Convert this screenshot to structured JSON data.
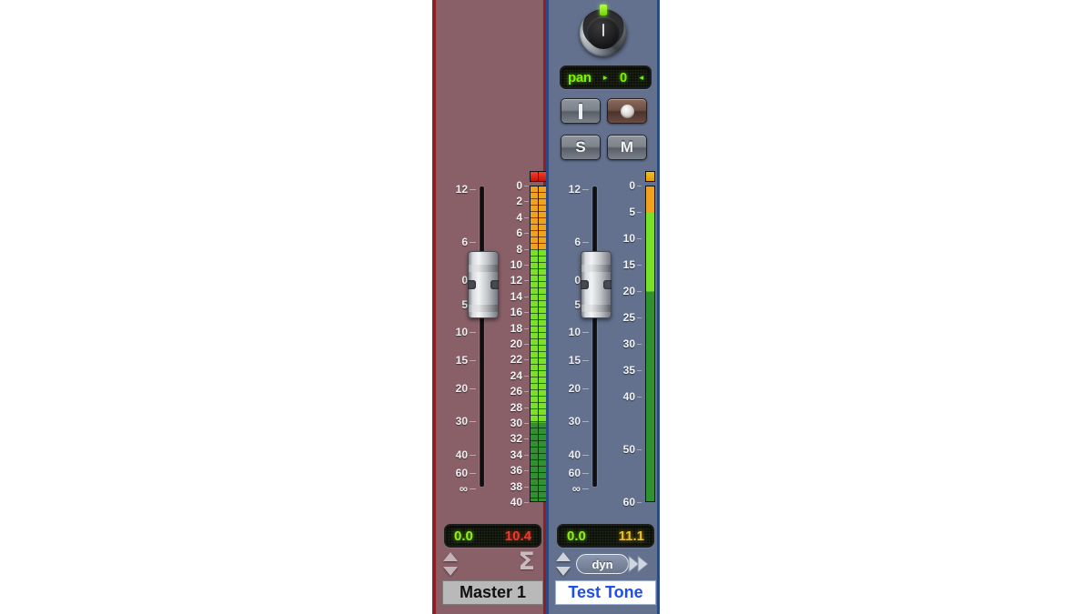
{
  "app": {
    "kind": "audio-mixer-channel-strips",
    "colors": {
      "master_strip_bg": "#8a6068",
      "master_strip_border": "#8e1f22",
      "track_strip_bg": "#63718f",
      "track_strip_border": "#2a4a86",
      "lcd_green": "#7bf007",
      "clip_red": "#d81f12",
      "peak_amber": "#f2c018",
      "meter_orange": "#f0a21e",
      "meter_green_bright": "#7ae02a",
      "meter_green_dark": "#2f9130"
    }
  },
  "strips": [
    {
      "id": "master",
      "name_label": "Master 1",
      "name_color": "#101010",
      "name_bg": "#b9b9b9",
      "has_pan_knob": false,
      "has_buttons": false,
      "fader": {
        "position_db": "0",
        "scale_labels": [
          "12",
          "6",
          "0",
          "5",
          "10",
          "15",
          "20",
          "30",
          "40",
          "60",
          "∞"
        ]
      },
      "meter": {
        "style": "stereo-segmented",
        "scale_labels": [
          "0",
          "2",
          "4",
          "6",
          "8",
          "10",
          "12",
          "14",
          "16",
          "18",
          "20",
          "22",
          "24",
          "26",
          "28",
          "30",
          "32",
          "34",
          "36",
          "38",
          "40"
        ],
        "clip_indicator": "on",
        "clip_color": "#d81f12",
        "orange_from_db": 0,
        "orange_to_db": 8,
        "bright_green_to_db": 30,
        "dark_green_to_db": 40,
        "level_db": 0
      },
      "value_display": {
        "left": "0.0",
        "right": "10.4",
        "left_color": "#8ef016",
        "right_color": "#f0392a"
      },
      "bottom_icons": {
        "spinner": "updown-spinner-icon",
        "right": "sigma-icon",
        "right_glyph": "Σ"
      }
    },
    {
      "id": "track",
      "name_label": "Test Tone",
      "name_color": "#1d4ff0",
      "name_bg": "#ffffff",
      "has_pan_knob": true,
      "has_buttons": true,
      "pan": {
        "label": "pan",
        "value": "0",
        "left_arrow": "▸",
        "right_arrow": "◂"
      },
      "buttons": [
        {
          "id": "input",
          "label": "I",
          "icon": "input-bar-icon",
          "state": "off"
        },
        {
          "id": "record",
          "label": "",
          "icon": "record-dot-icon",
          "state": "armed"
        },
        {
          "id": "solo",
          "label": "S",
          "icon": "",
          "state": "off"
        },
        {
          "id": "mute",
          "label": "M",
          "icon": "",
          "state": "off"
        }
      ],
      "fader": {
        "position_db": "0",
        "scale_labels": [
          "12",
          "6",
          "0",
          "5",
          "10",
          "15",
          "20",
          "30",
          "40",
          "60",
          "∞"
        ]
      },
      "meter": {
        "style": "mono-continuous",
        "scale_labels": [
          "0",
          "5",
          "10",
          "15",
          "20",
          "25",
          "30",
          "35",
          "40",
          "50",
          "60"
        ],
        "clip_indicator": "peak",
        "clip_color": "#f2c018",
        "orange_from_db": 0,
        "orange_to_db": 5,
        "bright_green_to_db": 20,
        "dark_green_to_db": 60,
        "level_db": 0
      },
      "value_display": {
        "left": "0.0",
        "right": "11.1",
        "left_color": "#8ef016",
        "right_color": "#f2c018"
      },
      "bottom_icons": {
        "spinner": "updown-spinner-icon",
        "center_pill": "dyn",
        "right": "sends-arrows-icon"
      }
    }
  ]
}
